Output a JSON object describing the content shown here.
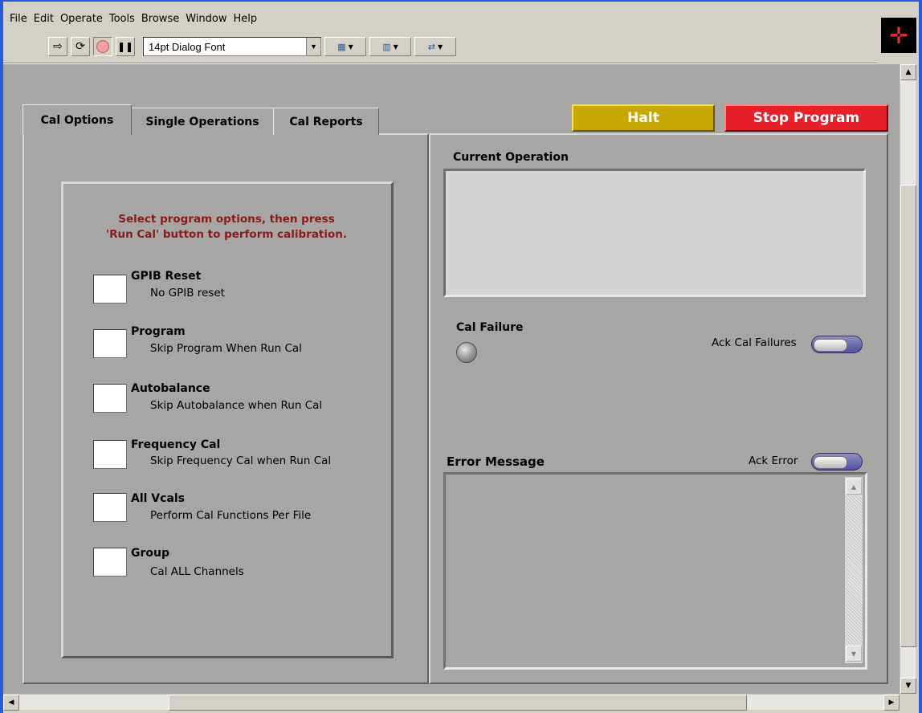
{
  "menu": {
    "items": [
      "File",
      "Edit",
      "Operate",
      "Tools",
      "Browse",
      "Window",
      "Help"
    ]
  },
  "toolbar": {
    "font_select": "14pt Dialog Font",
    "icons": [
      "run-arrow-icon",
      "run-continuous-icon",
      "abort-icon",
      "pause-icon",
      "align-icon",
      "distribute-icon",
      "reorder-icon"
    ]
  },
  "tabs": [
    {
      "label": "Cal Options",
      "active": true
    },
    {
      "label": "Single Operations",
      "active": false
    },
    {
      "label": "Cal Reports",
      "active": false
    }
  ],
  "buttons": {
    "halt": "Halt",
    "stop": "Stop  Program"
  },
  "cal_options": {
    "instruction_line1": "Select program options, then press",
    "instruction_line2": "'Run Cal' button to perform calibration.",
    "options": [
      {
        "title": "GPIB Reset",
        "desc": "No GPIB reset"
      },
      {
        "title": "Program",
        "desc": "Skip Program When Run Cal"
      },
      {
        "title": "Autobalance",
        "desc": "Skip Autobalance when Run Cal"
      },
      {
        "title": "Frequency Cal",
        "desc": "Skip Frequency Cal when Run Cal"
      },
      {
        "title": "All Vcals",
        "desc": "Perform Cal Functions Per File"
      },
      {
        "title": "Group",
        "desc": "Cal ALL Channels"
      }
    ]
  },
  "status": {
    "current_operation_label": "Current Operation",
    "current_operation_value": "",
    "cal_failure_label": "Cal Failure",
    "ack_cal_failures_label": "Ack Cal Failures",
    "error_message_label": "Error Message",
    "ack_error_label": "Ack Error",
    "error_message_value": ""
  },
  "colors": {
    "panel": "#a8a6a4",
    "instruction_text": "#8b1a1a",
    "halt": "#c8a800",
    "stop": "#e8202a"
  }
}
